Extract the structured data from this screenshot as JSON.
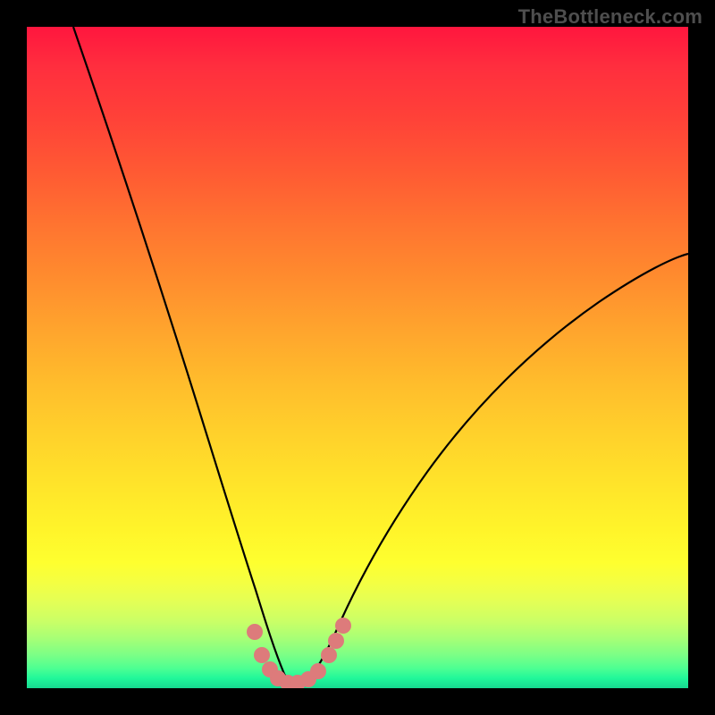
{
  "watermark": "TheBottleneck.com",
  "colors": {
    "frame": "#000000",
    "curve": "#000000",
    "marker_fill": "#dd7b7b",
    "gradient_top": "#ff163e",
    "gradient_bottom": "#17d890"
  },
  "chart_data": {
    "type": "line",
    "title": "",
    "xlabel": "",
    "ylabel": "",
    "xlim": [
      0,
      100
    ],
    "ylim": [
      0,
      100
    ],
    "note": "Axes have no tick labels; values below are estimated percentages of plot width (x) and plot height (y) measured from the bottom-left of the colored plot area.",
    "series": [
      {
        "name": "bottleneck-curve",
        "x": [
          7,
          10,
          14,
          18,
          22,
          26,
          29,
          31,
          33,
          34.5,
          36,
          37.5,
          39,
          40.5,
          42,
          44,
          47,
          51,
          56,
          62,
          69,
          77,
          86,
          95,
          100
        ],
        "y": [
          100,
          89,
          77,
          65,
          53,
          40,
          29,
          21,
          14,
          9,
          5,
          2.5,
          1,
          0.5,
          1,
          2.5,
          6,
          12,
          20,
          29,
          38,
          47,
          55,
          62,
          65
        ]
      }
    ],
    "markers": {
      "name": "highlighted-points",
      "x": [
        34.5,
        35.5,
        36.8,
        38.0,
        39.5,
        41.0,
        42.5,
        44.0,
        45.7,
        46.7,
        47.8
      ],
      "y": [
        8.5,
        5.0,
        2.8,
        1.5,
        0.8,
        0.8,
        1.3,
        2.5,
        5.0,
        7.2,
        9.5
      ]
    }
  }
}
